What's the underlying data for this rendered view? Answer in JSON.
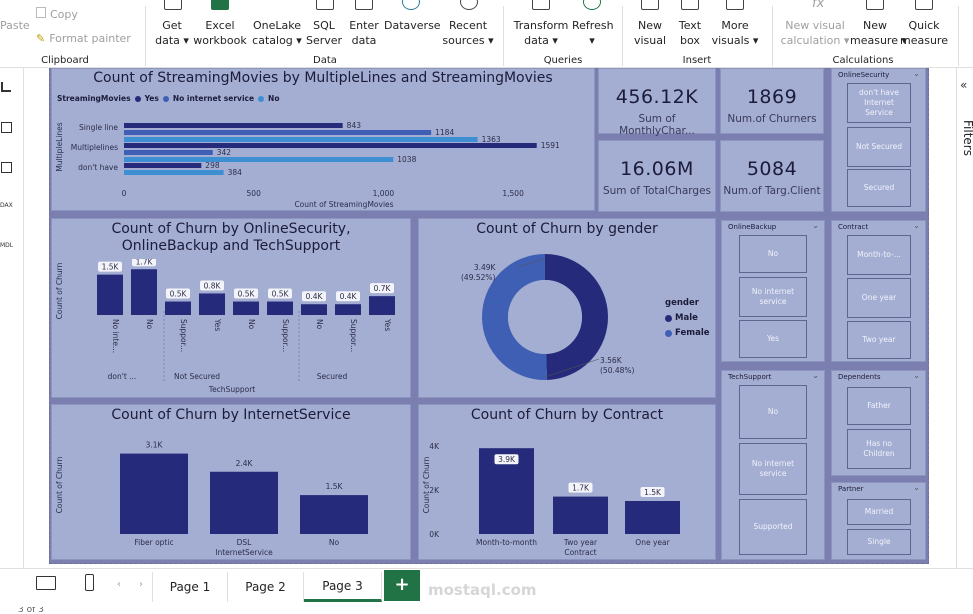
{
  "ribbon": {
    "paste": "Paste",
    "copy": "Copy",
    "format_painter": "Format painter",
    "get_data": [
      "Get",
      "data ▾"
    ],
    "excel": [
      "Excel",
      "workbook"
    ],
    "onelake": [
      "OneLake",
      "catalog ▾"
    ],
    "sql": [
      "SQL",
      "Server"
    ],
    "enter": [
      "Enter",
      "data"
    ],
    "dataverse": "Dataverse",
    "recent": [
      "Recent",
      "sources ▾"
    ],
    "transform": [
      "Transform",
      "data ▾"
    ],
    "refresh": [
      "Refresh",
      "▾"
    ],
    "new_visual": [
      "New",
      "visual"
    ],
    "text_box": [
      "Text",
      "box"
    ],
    "more_visuals": [
      "More",
      "visuals ▾"
    ],
    "new_visual_calc": [
      "New visual",
      "calculation ▾"
    ],
    "new_measure": [
      "New",
      "measure ▾"
    ],
    "quick_measure": [
      "Quick",
      "measure"
    ],
    "groups": {
      "clipboard": "Clipboard",
      "data": "Data",
      "queries": "Queries",
      "insert": "Insert",
      "calculations": "Calculations"
    }
  },
  "filters_label": "Filters",
  "chart1": {
    "title": "Count of StreamingMovies by MultipleLines and StreamingMovies",
    "legend_title": "StreamingMovies",
    "legend": [
      "Yes",
      "No internet service",
      "No"
    ],
    "ylabel": "MultipleLines",
    "xlabel": "Count of StreamingMovies"
  },
  "chart2": {
    "title": "Count of Churn by OnlineSecurity, OnlineBackup and TechSupport",
    "xlabel": "TechSupport",
    "ylabel": "Count of Churn"
  },
  "chart3": {
    "title": "Count of Churn by gender",
    "legend_title": "gender",
    "legend": [
      "Male",
      "Female"
    ],
    "label1": [
      "3.49K",
      "(49.52%)"
    ],
    "label2": [
      "3.56K",
      "(50.48%)"
    ]
  },
  "chart4": {
    "title": "Count of Churn by InternetService",
    "xlabel": "InternetService",
    "ylabel": "Count of Churn"
  },
  "chart5": {
    "title": "Count of Churn by Contract",
    "xlabel": "Contract",
    "ylabel": "Count of Churn"
  },
  "kpis": [
    {
      "value": "456.12K",
      "label": "Sum of MonthlyChar..."
    },
    {
      "value": "1869",
      "label": "Num.of Churners"
    },
    {
      "value": "16.06M",
      "label": "Sum of TotalCharges"
    },
    {
      "value": "5084",
      "label": "Num.of Targ.Client"
    }
  ],
  "slicers": {
    "online_security": {
      "title": "OnlineSecurity",
      "items": [
        "don't have Internet Service",
        "Not Secured",
        "Secured"
      ]
    },
    "online_backup": {
      "title": "OnlineBackup",
      "items": [
        "No",
        "No internet service",
        "Yes"
      ]
    },
    "contract": {
      "title": "Contract",
      "items": [
        "Month-to-...",
        "One year",
        "Two year"
      ]
    },
    "tech_support": {
      "title": "TechSupport",
      "items": [
        "No",
        "No internet service",
        "Supported"
      ]
    },
    "dependents": {
      "title": "Dependents",
      "items": [
        "Father",
        "Has no Children"
      ]
    },
    "partner": {
      "title": "Partner",
      "items": [
        "Married",
        "Single"
      ]
    }
  },
  "pages": [
    "Page 1",
    "Page 2",
    "Page 3"
  ],
  "add_page": "+",
  "watermark": "mostaql.com",
  "status": "3 of 3",
  "colors": {
    "navy": "#262a7a",
    "mid": "#3f5fb4",
    "light": "#3e8fd1",
    "panel": "#a3aed2",
    "canvas": "#7a7fb0",
    "accent": "#217346"
  },
  "chart_data": [
    {
      "type": "bar",
      "orientation": "horizontal",
      "categories": [
        "Single line",
        "Multiplelines",
        "don't have"
      ],
      "series": [
        {
          "name": "Yes",
          "values": [
            843,
            1591,
            298
          ]
        },
        {
          "name": "No internet service",
          "values": [
            1184,
            342,
            null
          ]
        },
        {
          "name": "No",
          "values": [
            1363,
            1038,
            384
          ]
        }
      ],
      "xticks": [
        "0",
        "500",
        "1,000",
        "1,500"
      ],
      "xlim": [
        0,
        1700
      ]
    },
    {
      "type": "bar",
      "categories": [
        "No inte...",
        "No",
        "Suppor...",
        "Yes",
        "No",
        "Suppor...",
        "No",
        "Suppor...",
        "Yes"
      ],
      "groups": [
        "don't ...",
        "Not Secured",
        "Secured"
      ],
      "labels": [
        "1.5K",
        "1.7K",
        "0.5K",
        "0.8K",
        "0.5K",
        "0.5K",
        "0.4K",
        "0.4K",
        "0.7K"
      ],
      "values": [
        1500,
        1700,
        500,
        800,
        500,
        500,
        400,
        400,
        700
      ],
      "ylim": [
        0,
        1800
      ]
    },
    {
      "type": "pie",
      "categories": [
        "Male",
        "Female"
      ],
      "values": [
        3490,
        3560
      ]
    },
    {
      "type": "bar",
      "categories": [
        "Fiber optic",
        "DSL",
        "No"
      ],
      "labels": [
        "3.1K",
        "2.4K",
        "1.5K"
      ],
      "values": [
        3100,
        2400,
        1500
      ],
      "ylim": [
        0,
        3200
      ]
    },
    {
      "type": "bar",
      "categories": [
        "Month-to-month",
        "Two year",
        "One year"
      ],
      "labels": [
        "3.9K",
        "1.7K",
        "1.5K"
      ],
      "values": [
        3900,
        1700,
        1500
      ],
      "yticks": [
        "4K",
        "2K",
        "0K"
      ],
      "ylim": [
        0,
        4000
      ]
    }
  ]
}
